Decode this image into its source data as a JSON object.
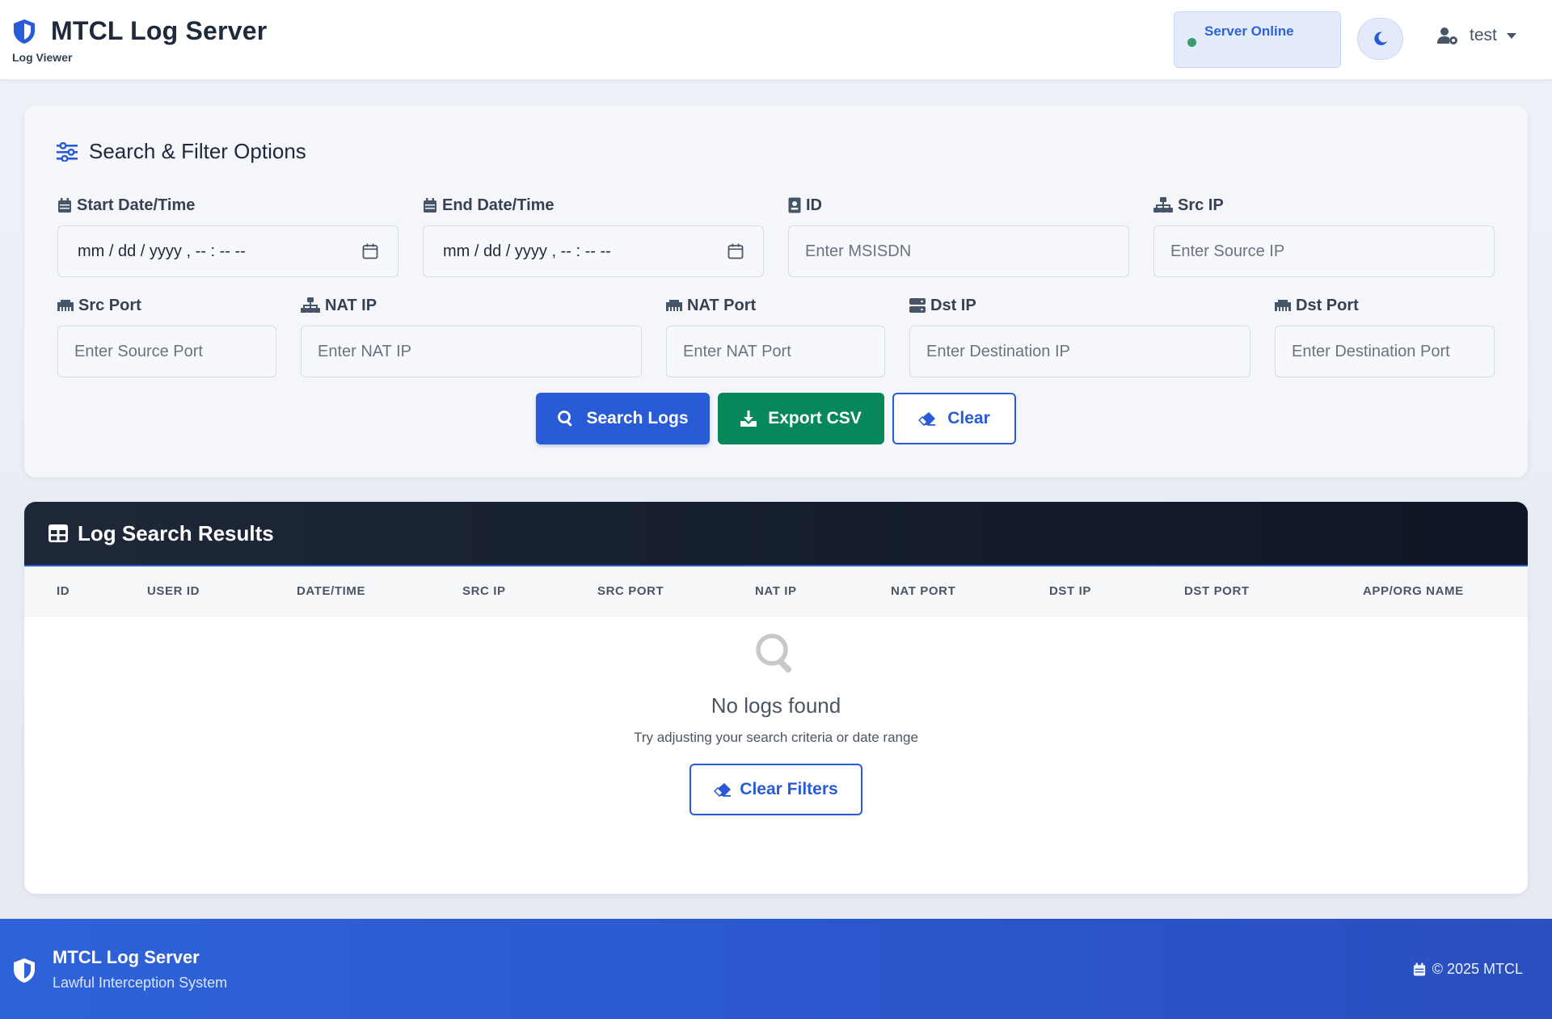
{
  "header": {
    "app_title": "MTCL Log Server",
    "subtitle": "Log Viewer",
    "status": "Server Online",
    "username": "test"
  },
  "filters": {
    "title": "Search & Filter Options",
    "fields": {
      "start_date": {
        "label": "Start Date/Time",
        "value": "mm / dd / yyyy ,  -- : --   --"
      },
      "end_date": {
        "label": "End Date/Time",
        "value": "mm / dd / yyyy ,  -- : --   --"
      },
      "id": {
        "label": "ID",
        "placeholder": "Enter MSISDN"
      },
      "src_ip": {
        "label": "Src IP",
        "placeholder": "Enter Source IP"
      },
      "src_port": {
        "label": "Src Port",
        "placeholder": "Enter Source Port"
      },
      "nat_ip": {
        "label": "NAT IP",
        "placeholder": "Enter NAT IP"
      },
      "nat_port": {
        "label": "NAT Port",
        "placeholder": "Enter NAT Port"
      },
      "dst_ip": {
        "label": "Dst IP",
        "placeholder": "Enter Destination IP"
      },
      "dst_port": {
        "label": "Dst Port",
        "placeholder": "Enter Destination Port"
      }
    },
    "buttons": {
      "search": "Search Logs",
      "export": "Export CSV",
      "clear": "Clear"
    }
  },
  "results": {
    "title": "Log Search Results",
    "columns": [
      "ID",
      "USER ID",
      "DATE/TIME",
      "SRC IP",
      "SRC PORT",
      "NAT IP",
      "NAT PORT",
      "DST IP",
      "DST PORT",
      "APP/ORG NAME"
    ],
    "empty_title": "No logs found",
    "empty_subtitle": "Try adjusting your search criteria or date range",
    "clear_filters": "Clear Filters"
  },
  "footer": {
    "title": "MTCL Log Server",
    "subtitle": "Lawful Interception System",
    "copyright": "© 2025 MTCL"
  },
  "colors": {
    "primary": "#2a5bd7",
    "success": "#07875a",
    "dark_header": "#1e2838",
    "status_dot": "#3a9e6c"
  }
}
